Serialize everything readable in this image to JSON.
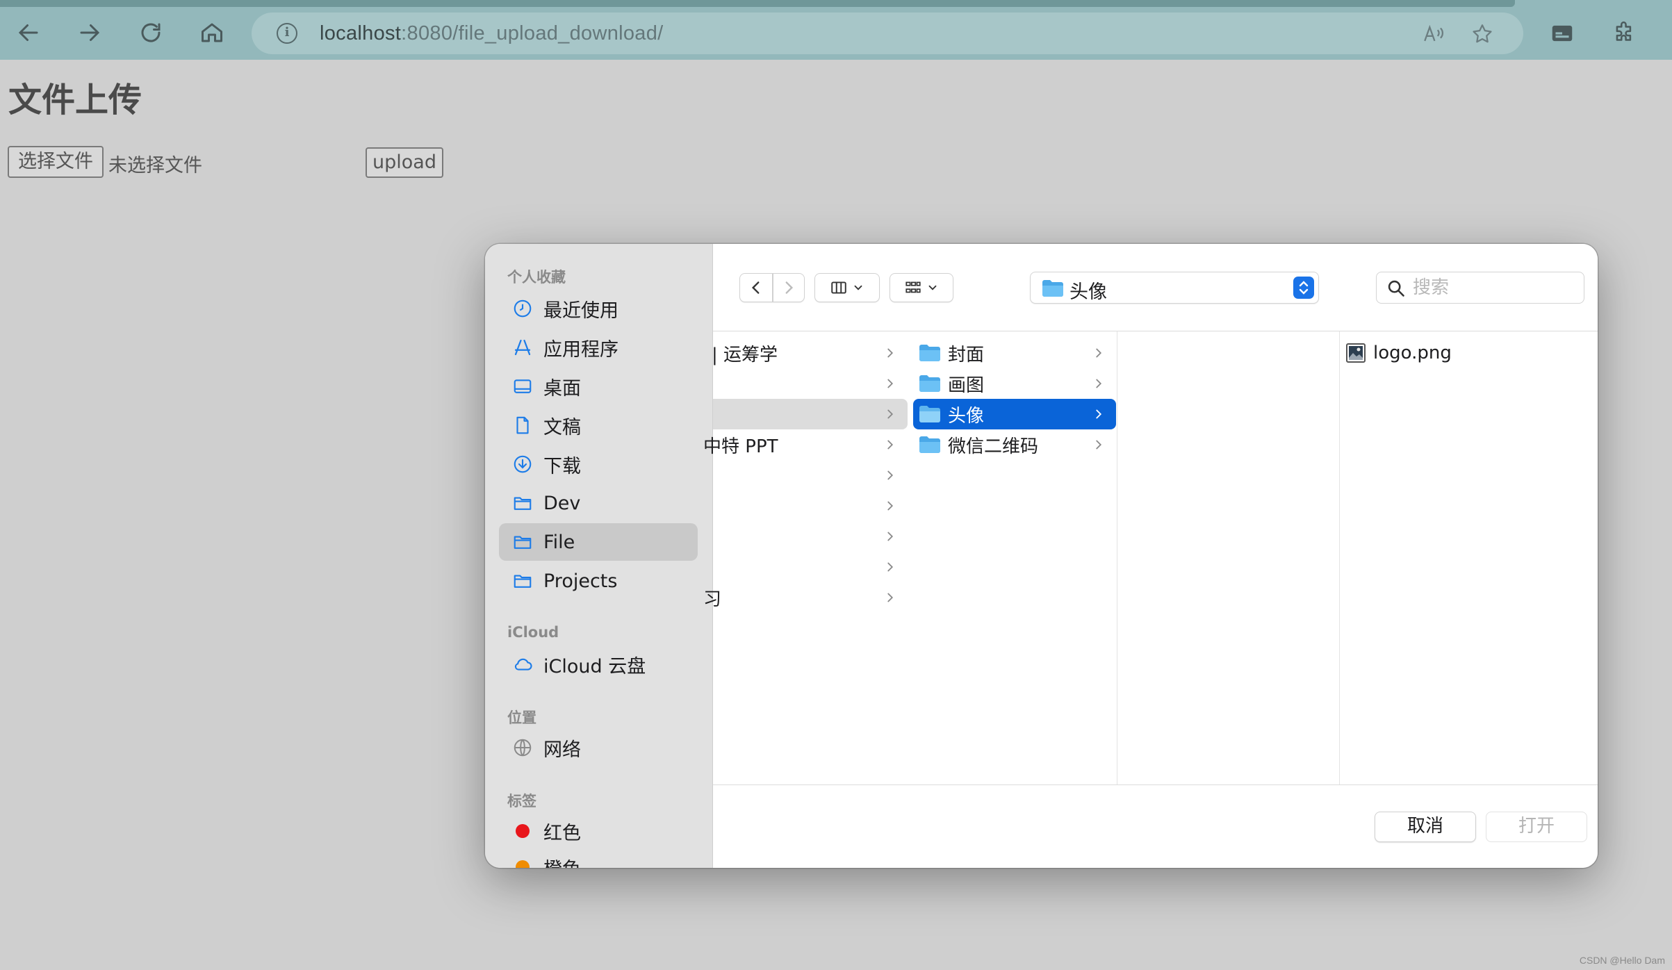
{
  "browser": {
    "url_host": "localhost",
    "url_rest": ":8080/file_upload_download/"
  },
  "page": {
    "title": "文件上传",
    "choose_file_label": "选择文件",
    "no_file_text": "未选择文件",
    "upload_label": "upload"
  },
  "dialog": {
    "sidebar": {
      "favorites_heading": "个人收藏",
      "favorites": [
        {
          "label": "最近使用",
          "icon": "clock-icon"
        },
        {
          "label": "应用程序",
          "icon": "apps-icon"
        },
        {
          "label": "桌面",
          "icon": "desktop-icon"
        },
        {
          "label": "文稿",
          "icon": "document-icon"
        },
        {
          "label": "下载",
          "icon": "download-icon"
        },
        {
          "label": "Dev",
          "icon": "folder-icon"
        },
        {
          "label": "File",
          "icon": "folder-icon",
          "selected": true
        },
        {
          "label": "Projects",
          "icon": "folder-icon"
        }
      ],
      "icloud_heading": "iCloud",
      "icloud_item": "iCloud 云盘",
      "locations_heading": "位置",
      "network_item": "网络",
      "tags_heading": "标签",
      "tag_red": "红色",
      "tag_orange": "橙色"
    },
    "toolbar": {
      "current_folder": "头像",
      "search_placeholder": "搜索"
    },
    "column1": [
      "| 运筹学",
      "",
      "",
      "中特 PPT",
      "",
      "",
      "",
      "",
      "习"
    ],
    "column2": [
      "封面",
      "画图",
      "头像",
      "微信二维码"
    ],
    "column3": [
      "logo.png"
    ],
    "buttons": {
      "cancel": "取消",
      "open": "打开"
    }
  },
  "watermark": "CSDN @Hello Dam",
  "colors": {
    "accent": "#0a64d8",
    "tag_red": "#e8161b",
    "tag_orange": "#f08c00",
    "browser_bar": "#93b8bb"
  }
}
